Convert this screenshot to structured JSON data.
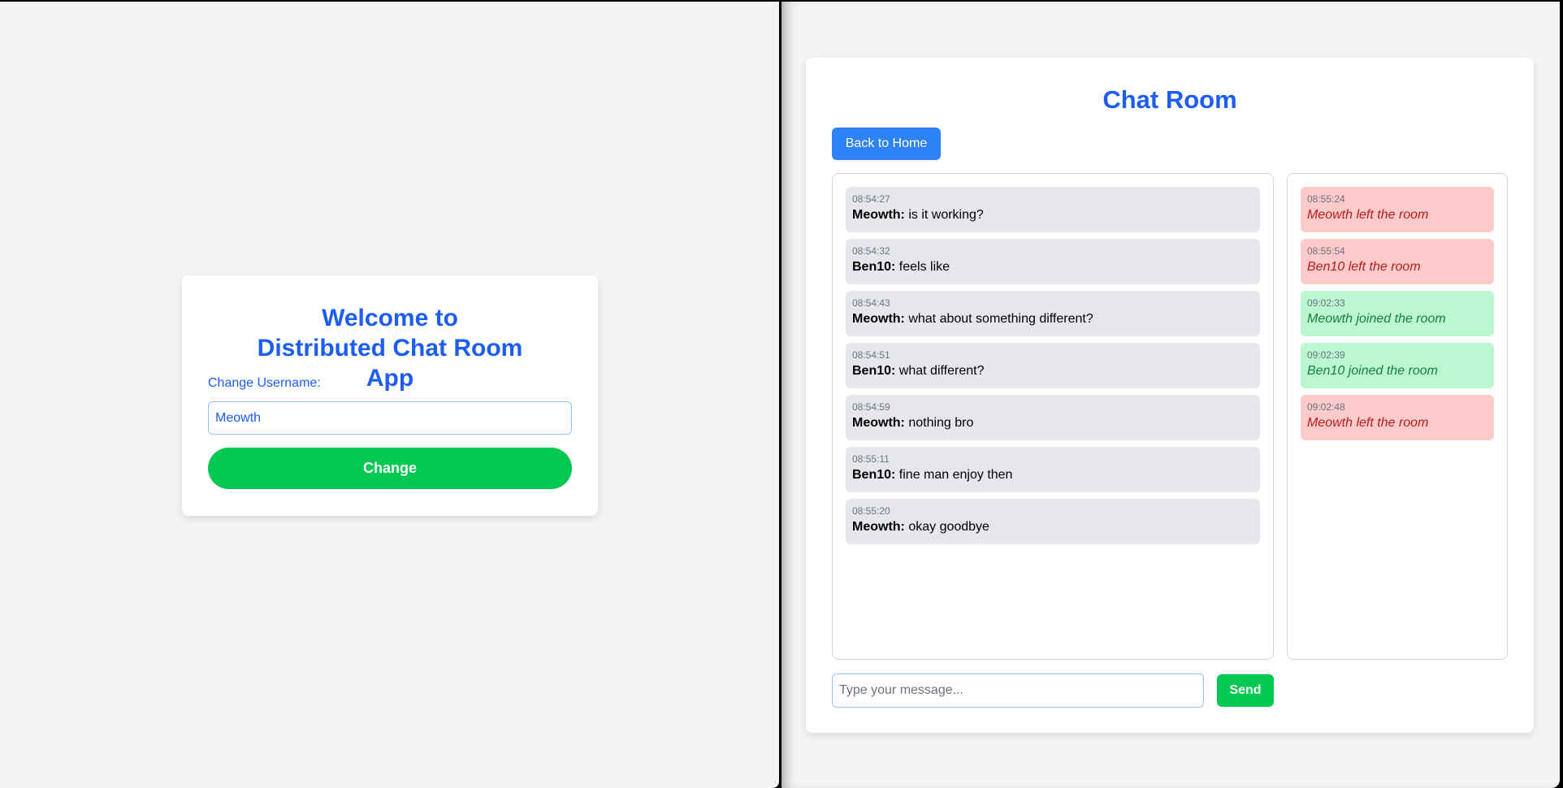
{
  "welcome": {
    "title": "Welcome to Distributed Chat Room App",
    "username_label": "Change Username:",
    "username_value": "Meowth",
    "change_button": "Change"
  },
  "chat": {
    "title": "Chat Room",
    "back_button": "Back to Home",
    "messages": [
      {
        "time": "08:54:27",
        "user": "Meowth:",
        "text": " is it working?"
      },
      {
        "time": "08:54:32",
        "user": "Ben10:",
        "text": " feels like"
      },
      {
        "time": "08:54:43",
        "user": "Meowth:",
        "text": " what about something different?"
      },
      {
        "time": "08:54:51",
        "user": "Ben10:",
        "text": " what different?"
      },
      {
        "time": "08:54:59",
        "user": "Meowth:",
        "text": " nothing bro"
      },
      {
        "time": "08:55:11",
        "user": "Ben10:",
        "text": " fine man enjoy then"
      },
      {
        "time": "08:55:20",
        "user": "Meowth:",
        "text": " okay goodbye"
      }
    ],
    "events": [
      {
        "time": "08:55:24",
        "text": "Meowth left the room",
        "type": "left"
      },
      {
        "time": "08:55:54",
        "text": "Ben10 left the room",
        "type": "left"
      },
      {
        "time": "09:02:33",
        "text": "Meowth joined the room",
        "type": "join"
      },
      {
        "time": "09:02:39",
        "text": "Ben10 joined the room",
        "type": "join"
      },
      {
        "time": "09:02:48",
        "text": "Meowth left the room",
        "type": "left"
      }
    ],
    "input_placeholder": "Type your message...",
    "send_button": "Send"
  },
  "colors": {
    "accent": "#1d5cf5",
    "button_blue": "#2f83f8",
    "green": "#00c850",
    "left_bg": "#fecaca",
    "join_bg": "#bbf7d0"
  }
}
